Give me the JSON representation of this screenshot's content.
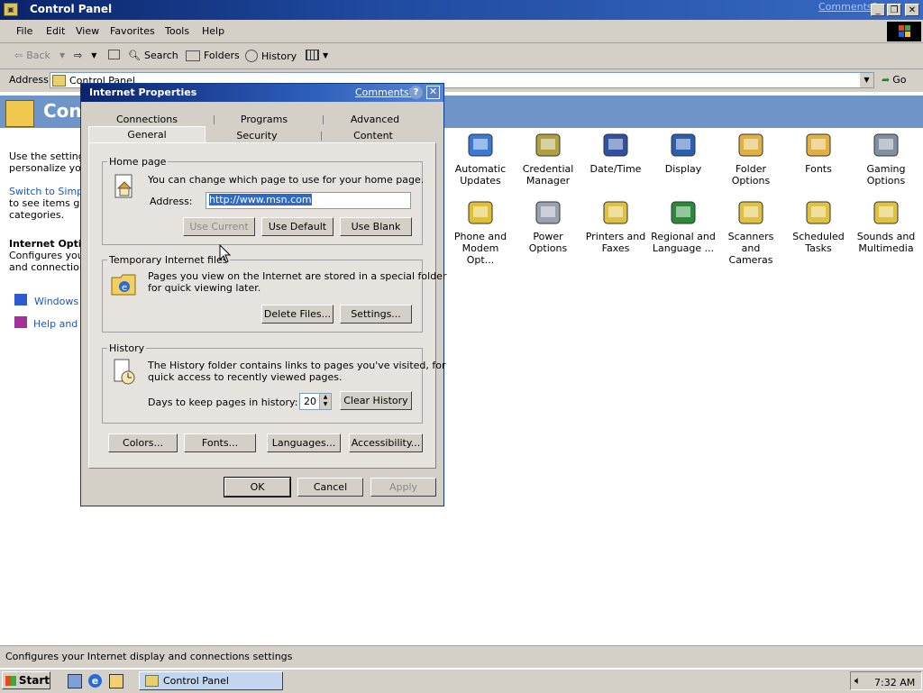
{
  "window": {
    "title": "Control Panel",
    "comments_link": "Comments?",
    "menu": [
      "File",
      "Edit",
      "View",
      "Favorites",
      "Tools",
      "Help"
    ],
    "toolbar": {
      "back": "Back",
      "search": "Search",
      "folders": "Folders",
      "history": "History"
    },
    "address_label": "Address",
    "address_value": "Control Panel",
    "go_label": "Go"
  },
  "banner": {
    "title": "Control Panel"
  },
  "left_pane": {
    "intro": "Use the settings in Control Panel to personalize your computer.",
    "intro_lines": [
      "Use the settings",
      "personalize your"
    ],
    "switch_link_lines": [
      "Switch to Simple"
    ],
    "switch_tail_lines": [
      "to see items gro",
      "categories."
    ],
    "section_title": "Internet Optio",
    "section_desc_lines": [
      "Configures your",
      "and connections"
    ],
    "links": [
      "Windows U",
      "Help and S"
    ]
  },
  "control_panel_items": [
    {
      "label_lines": [
        "Automatic",
        "Updates"
      ],
      "icon": "globe-update-icon"
    },
    {
      "label_lines": [
        "Credential",
        "Manager"
      ],
      "icon": "keys-icon"
    },
    {
      "label_lines": [
        "Date/Time",
        ""
      ],
      "icon": "calendar-clock-icon"
    },
    {
      "label_lines": [
        "Display",
        ""
      ],
      "icon": "monitor-icon"
    },
    {
      "label_lines": [
        "Folder Options",
        ""
      ],
      "icon": "folder-options-icon"
    },
    {
      "label_lines": [
        "Fonts",
        ""
      ],
      "icon": "fonts-folder-icon"
    },
    {
      "label_lines": [
        "Gaming",
        "Options"
      ],
      "icon": "joystick-icon"
    },
    {
      "label_lines": [
        "Phone and",
        "Modem Opt..."
      ],
      "icon": "phone-icon"
    },
    {
      "label_lines": [
        "Power Options",
        ""
      ],
      "icon": "power-plug-icon"
    },
    {
      "label_lines": [
        "Printers and",
        "Faxes"
      ],
      "icon": "printer-folder-icon"
    },
    {
      "label_lines": [
        "Regional and",
        "Language ..."
      ],
      "icon": "globe-icon"
    },
    {
      "label_lines": [
        "Scanners and",
        "Cameras"
      ],
      "icon": "scanner-camera-icon"
    },
    {
      "label_lines": [
        "Scheduled",
        "Tasks"
      ],
      "icon": "scheduled-tasks-icon"
    },
    {
      "label_lines": [
        "Sounds and",
        "Multimedia"
      ],
      "icon": "speaker-icon"
    }
  ],
  "status_bar": {
    "text": "Configures your Internet display and connections settings"
  },
  "taskbar": {
    "start": "Start",
    "task": "Control Panel",
    "clock": "7:32 AM"
  },
  "dialog": {
    "title": "Internet Properties",
    "comments": "Comments?",
    "help": "?",
    "close": "✕",
    "tabs_row1": [
      "Connections",
      "Programs",
      "Advanced"
    ],
    "tabs_row2": [
      "General",
      "Security",
      "Content"
    ],
    "home_page": {
      "legend": "Home page",
      "desc": "You can change which page to use for your home page.",
      "address_label": "Address:",
      "address_value": "http://www.msn.com",
      "use_current": "Use Current",
      "use_default": "Use Default",
      "use_blank": "Use Blank"
    },
    "temp_files": {
      "legend": "Temporary Internet files",
      "desc_lines": [
        "Pages you view on the Internet are stored in a special folder",
        "for quick viewing later."
      ],
      "delete_files": "Delete Files...",
      "settings": "Settings..."
    },
    "history": {
      "legend": "History",
      "desc_lines": [
        "The History folder contains links to pages you've visited, for",
        "quick access to recently viewed pages."
      ],
      "days_label": "Days to keep pages in history:",
      "days_value": "20",
      "clear": "Clear History"
    },
    "bottom_buttons": [
      "Colors...",
      "Fonts...",
      "Languages...",
      "Accessibility..."
    ],
    "ok": "OK",
    "cancel": "Cancel",
    "apply": "Apply"
  },
  "colors": {
    "titlebar": "#0a246a",
    "link": "#1b54c6",
    "selection": "#316ac5",
    "face": "#d4d0c8"
  }
}
